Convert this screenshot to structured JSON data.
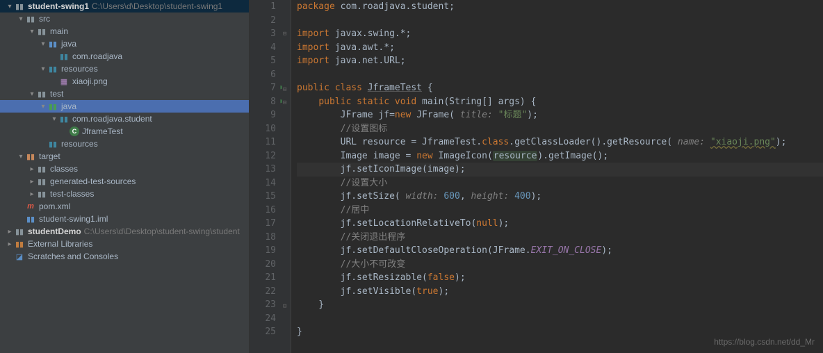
{
  "tree": {
    "project": "student-swing1",
    "projectPath": "C:\\Users\\d\\Desktop\\student-swing1",
    "src": "src",
    "main": "main",
    "main_java": "java",
    "main_pkg": "com.roadjava",
    "resources": "resources",
    "xiaoji": "xiaoji.png",
    "test": "test",
    "test_java": "java",
    "test_pkg": "com.roadjava.student",
    "jframetest": "JframeTest",
    "resources2": "resources",
    "target": "target",
    "classes": "classes",
    "gen": "generated-test-sources",
    "testclasses": "test-classes",
    "pom": "pom.xml",
    "iml": "student-swing1.iml",
    "demo": "studentDemo",
    "demoPath": "C:\\Users\\d\\Desktop\\student-swing\\student",
    "ext": "External Libraries",
    "scratch": "Scratches and Consoles"
  },
  "code": {
    "l1_pkg": "package",
    "l1_pkgname": "com.roadjava.student",
    "l3_imp": "import",
    "l3_a": "javax.swing.*",
    "l4_a": "java.awt.*",
    "l5_a": "java.net.URL",
    "l7_pub": "public class",
    "l7_cls": "JframeTest",
    "l8": "public static void",
    "l8_main": "main",
    "l8_args": "(String[] args) {",
    "l9_a": "JFrame jf=",
    "l9_new": "new",
    "l9_b": " JFrame(",
    "l9_p": " title: ",
    "l9_s": "\"标题\"",
    "l10": "//设置图标",
    "l11_a": "URL resource = JframeTest.",
    "l11_cls": "class",
    "l11_b": ".getClassLoader().getResource(",
    "l11_p": " name: ",
    "l11_s": "\"xiaoji.png\"",
    "l12_a": "Image image = ",
    "l12_new": "new",
    "l12_b": " ImageIcon(",
    "l12_r": "resource",
    "l12_c": ").getImage();",
    "l13": "jf.setIconImage(image);",
    "l14": "//设置大小",
    "l15_a": "jf.setSize(",
    "l15_p1": " width: ",
    "l15_v1": "600",
    "l15_c": ",",
    "l15_p2": " height: ",
    "l15_v2": "400",
    "l16": "//居中",
    "l17_a": "jf.setLocationRelativeTo(",
    "l17_n": "null",
    "l18": "//关闭退出程序",
    "l19_a": "jf.setDefaultCloseOperation(JFrame.",
    "l19_f": "EXIT_ON_CLOSE",
    "l20": "//大小不可改变",
    "l21_a": "jf.setResizable(",
    "l21_v": "false",
    "l22_a": "jf.setVisible(",
    "l22_v": "true"
  },
  "watermark": "https://blog.csdn.net/dd_Mr"
}
